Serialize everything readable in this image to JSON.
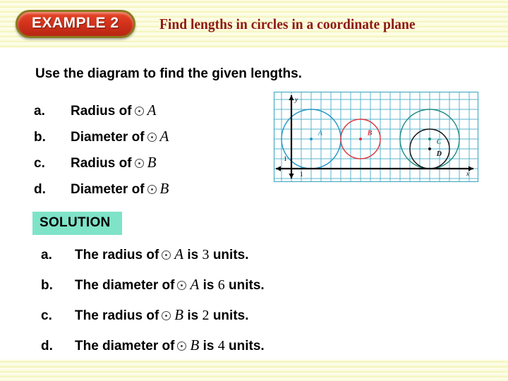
{
  "header": {
    "badge_label": "EXAMPLE 2",
    "title": "Find lengths in circles in a coordinate plane",
    "badge_color": "#d4331c",
    "badge_border_color": "#8a7a20",
    "title_color": "#8e1b12",
    "band_color": "#f5f5c0"
  },
  "main": {
    "prompt": "Use the diagram to find the given lengths.",
    "questions": [
      {
        "letter": "a.",
        "prefix": "Radius of",
        "symbol": "circle-dot-icon",
        "circle": "A"
      },
      {
        "letter": "b.",
        "prefix": "Diameter of",
        "symbol": "circle-dot-icon",
        "circle": "A"
      },
      {
        "letter": "c.",
        "prefix": "Radius of",
        "symbol": "circle-dot-icon",
        "circle": "B"
      },
      {
        "letter": "d.",
        "prefix": "Diameter of",
        "symbol": "circle-dot-icon",
        "circle": "B"
      }
    ]
  },
  "solution": {
    "label": "SOLUTION",
    "label_bg": "#7fe3c8",
    "items": [
      {
        "letter": "a.",
        "prefix": "The radius of",
        "circle": "A",
        "middle": "is",
        "value": "3",
        "suffix": "units."
      },
      {
        "letter": "b.",
        "prefix": "The diameter of",
        "circle": "A",
        "middle": "is",
        "value": "6",
        "suffix": "units."
      },
      {
        "letter": "c.",
        "prefix": "The radius of",
        "circle": "B",
        "middle": "is",
        "value": "2",
        "suffix": "units."
      },
      {
        "letter": "d.",
        "prefix": "The diameter of",
        "circle": "B",
        "middle": "is",
        "value": "4",
        "suffix": "units."
      }
    ]
  },
  "chart_data": {
    "type": "scatter",
    "title": "",
    "xlabel": "x",
    "ylabel": "y",
    "grid": true,
    "grid_color": "#59b4cc",
    "axis_color": "#000000",
    "cell_size": 1,
    "xlim": [
      -2,
      19
    ],
    "ylim": [
      -1,
      8
    ],
    "tick_labels": [
      {
        "axis": "x",
        "value": 1,
        "label": "1"
      },
      {
        "axis": "y",
        "value": 1,
        "label": "1"
      }
    ],
    "axis_arrowheads": [
      "x-positive",
      "x-negative",
      "y-positive",
      "y-negative"
    ],
    "circles": [
      {
        "name": "A",
        "center": [
          2,
          3
        ],
        "radius": 3,
        "color": "#2196c4",
        "label": "A",
        "label_offset": [
          0.7,
          0.6
        ],
        "center_dot": true
      },
      {
        "name": "B",
        "center": [
          7,
          3
        ],
        "radius": 2,
        "color": "#e0313c",
        "label": "B",
        "label_offset": [
          0.7,
          0.6
        ],
        "center_dot": true
      },
      {
        "name": "C",
        "center": [
          14,
          3
        ],
        "radius": 3,
        "color": "#1f8c80",
        "label": "C",
        "label_offset": [
          0.7,
          -0.3
        ],
        "center_dot": true
      },
      {
        "name": "D",
        "center": [
          14,
          2
        ],
        "radius": 2,
        "color": "#111111",
        "label": "D",
        "label_offset": [
          0.7,
          -0.5
        ],
        "center_dot": true
      }
    ]
  }
}
